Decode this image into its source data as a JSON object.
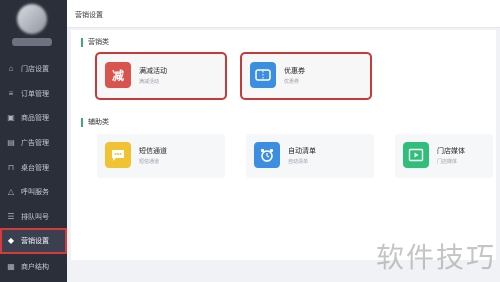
{
  "sidebar": {
    "items": [
      {
        "label": "门店设置",
        "icon": "home-icon"
      },
      {
        "label": "订单管理",
        "icon": "list-icon"
      },
      {
        "label": "商品管理",
        "icon": "box-icon"
      },
      {
        "label": "广告管理",
        "icon": "ad-icon"
      },
      {
        "label": "桌台管理",
        "icon": "table-icon"
      },
      {
        "label": "呼叫服务",
        "icon": "bell-icon"
      },
      {
        "label": "排队叫号",
        "icon": "queue-icon"
      },
      {
        "label": "营销设置",
        "icon": "marketing-icon"
      },
      {
        "label": "商户结构",
        "icon": "structure-icon"
      }
    ],
    "active_index": 7
  },
  "header": {
    "title": "营销设置"
  },
  "sections": [
    {
      "title": "营销类",
      "cards": [
        {
          "name": "满减活动",
          "desc": "满减活动",
          "icon": "discount-icon",
          "color": "#d9534f"
        },
        {
          "name": "优惠券",
          "desc": "优惠券",
          "icon": "ticket-icon",
          "color": "#3b8ee0"
        }
      ]
    },
    {
      "title": "辅助类",
      "cards": [
        {
          "name": "短信通道",
          "desc": "短信通道",
          "icon": "chat-icon",
          "color": "#f1c232"
        },
        {
          "name": "自动清单",
          "desc": "自动清单",
          "icon": "alarm-clock-icon",
          "color": "#3b8ee0"
        },
        {
          "name": "门店媒体",
          "desc": "门店媒体",
          "icon": "video-icon",
          "color": "#2fbf7a"
        }
      ]
    }
  ],
  "watermark": "软件技巧"
}
